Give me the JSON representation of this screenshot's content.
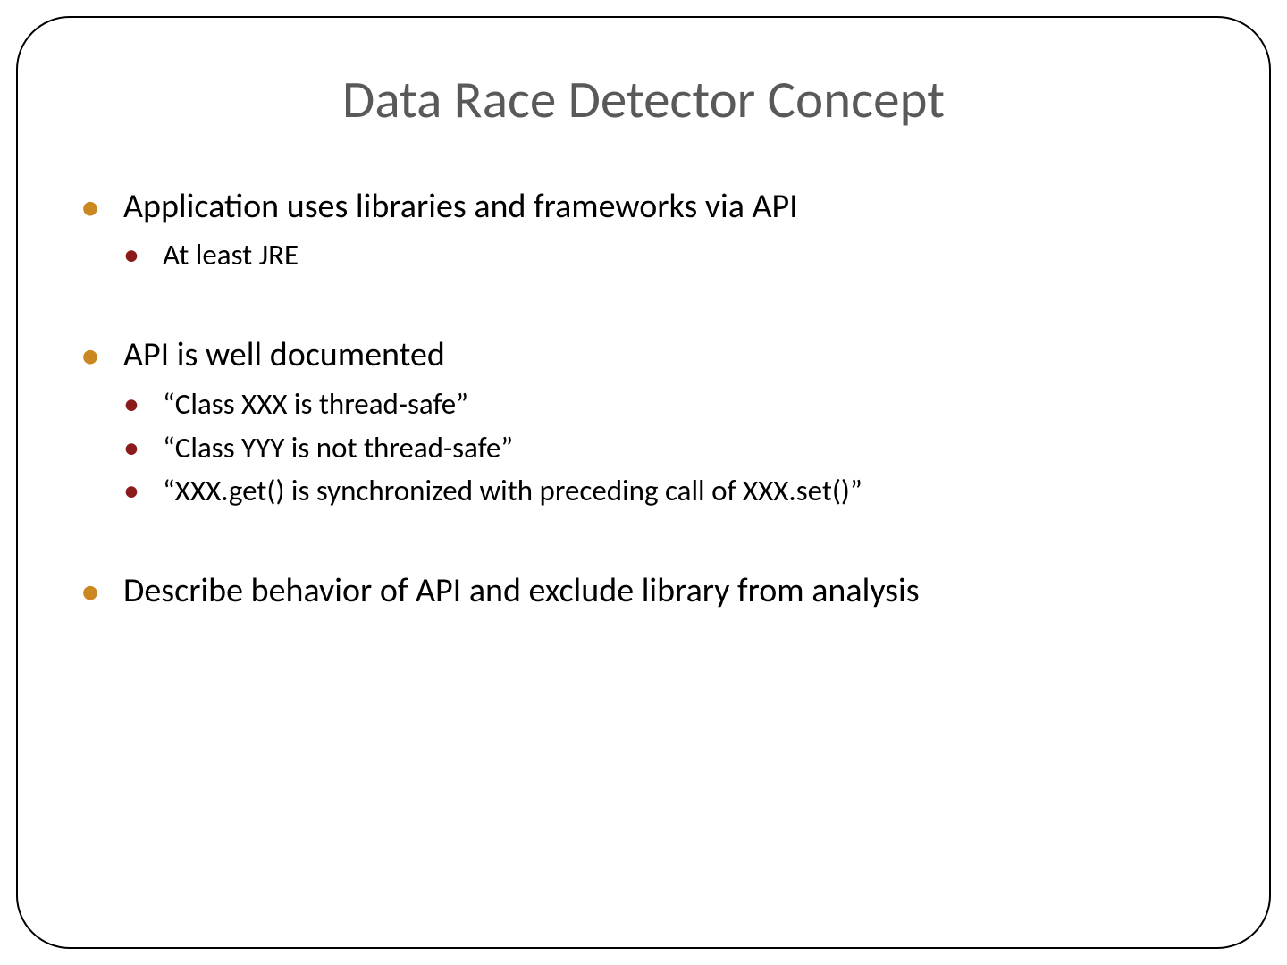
{
  "title": "Data Race Detector Concept",
  "bullets": [
    {
      "level": 1,
      "text": "Application uses libraries and frameworks via API"
    },
    {
      "level": 2,
      "text": "At least JRE"
    },
    {
      "level": 0,
      "text": ""
    },
    {
      "level": 1,
      "text": "API is well documented"
    },
    {
      "level": 2,
      "text": "“Class XXX is thread-safe”"
    },
    {
      "level": 2,
      "text": "“Class YYY is not thread-safe”"
    },
    {
      "level": 2,
      "text": "“XXX.get() is synchronized with preceding call of XXX.set()”"
    },
    {
      "level": 0,
      "text": ""
    },
    {
      "level": 1,
      "text": "Describe behavior of API and exclude library from analysis"
    }
  ]
}
